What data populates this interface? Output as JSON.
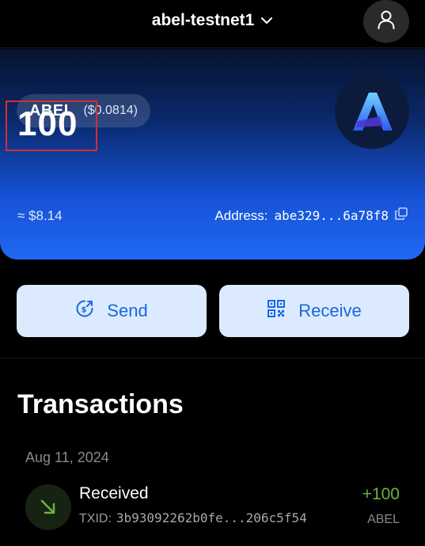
{
  "header": {
    "network_name": "abel-testnet1",
    "icons": [
      "chevron-down-icon",
      "user-icon"
    ]
  },
  "card": {
    "token_symbol": "ABEL",
    "token_price": "($0.0814)",
    "balance": "100",
    "fiat_value": "≈ $8.14",
    "address_label": "Address:",
    "address_value": "abe329...6a78f8",
    "icons": [
      "abel-logo-icon",
      "copy-icon"
    ]
  },
  "actions": {
    "send_label": "Send",
    "receive_label": "Receive",
    "icons": [
      "send-icon",
      "qr-code-icon"
    ]
  },
  "transactions": {
    "title": "Transactions",
    "groups": [
      {
        "date": "Aug 11, 2024",
        "items": [
          {
            "type": "Received",
            "txid_label": "TXID:",
            "txid": "3b93092262b0fe...206c5f54",
            "amount": "+100",
            "unit": "ABEL",
            "icon": "arrow-down-right-icon"
          }
        ]
      }
    ]
  },
  "colors": {
    "background": "#000000",
    "card_gradient_top": "#06122e",
    "card_gradient_bottom": "#1f68f2",
    "button_bg": "#dbeafe",
    "button_text": "#1a67e0",
    "positive_amount": "#6cb33f",
    "highlight_box": "#d32f2f"
  }
}
